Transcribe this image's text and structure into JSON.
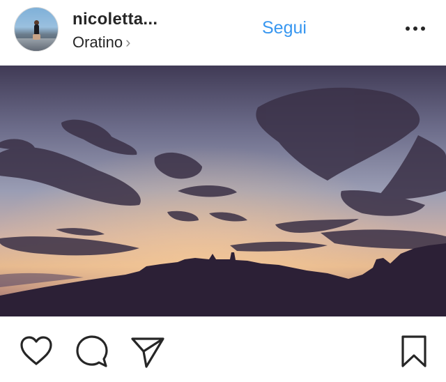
{
  "post": {
    "username": "nicoletta...",
    "location": "Oratino",
    "location_chevron": "›",
    "follow_label": "Segui"
  },
  "icons": {
    "avatar": "profile-photo",
    "more": "more-horizontal-icon",
    "like": "heart-icon",
    "comment": "comment-bubble-icon",
    "share": "paper-plane-icon",
    "save": "bookmark-icon"
  },
  "colors": {
    "accent": "#3897f0",
    "text": "#262626",
    "secondary": "#8e8e8e"
  }
}
